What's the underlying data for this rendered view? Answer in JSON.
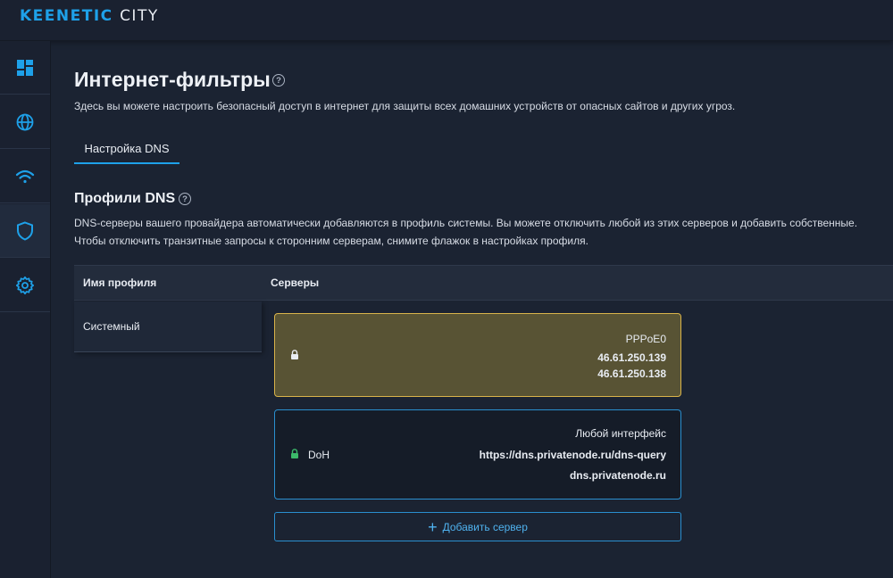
{
  "brand": {
    "name": "KEENETIC",
    "model": "CITY"
  },
  "sidebar": {
    "items": [
      {
        "name": "dashboard",
        "icon": "dashboard-icon"
      },
      {
        "name": "internet",
        "icon": "globe-icon"
      },
      {
        "name": "wifi",
        "icon": "wifi-icon"
      },
      {
        "name": "security",
        "icon": "shield-icon",
        "active": true
      },
      {
        "name": "settings",
        "icon": "gear-icon"
      }
    ]
  },
  "page": {
    "title": "Интернет-фильтры",
    "description": "Здесь вы можете настроить безопасный доступ в интернет для защиты всех домашних устройств от опасных сайтов и других угроз."
  },
  "tabs": [
    {
      "label": "Настройка DNS",
      "active": true
    }
  ],
  "section": {
    "title": "Профили DNS",
    "description_line1": "DNS-серверы вашего провайдера автоматически добавляются в профиль системы. Вы можете отключить любой из этих серверов и добавить собственные.",
    "description_line2": "Чтобы отключить транзитные запросы к сторонним серверам, снимите флажок в настройках профиля."
  },
  "table": {
    "col_profile": "Имя профиля",
    "col_servers": "Серверы",
    "profiles": [
      {
        "name": "Системный"
      }
    ]
  },
  "servers": [
    {
      "interface": "PPPoE0",
      "addresses": [
        "46.61.250.139",
        "46.61.250.138"
      ],
      "locked": true,
      "accent": "#d9b34a"
    },
    {
      "type": "DoH",
      "interface": "Любой интерфейс",
      "url": "https://dns.privatenode.ru/dns-query",
      "host": "dns.privatenode.ru",
      "lock_color": "#3cb96a",
      "accent": "#2a8fcf"
    }
  ],
  "add_server": {
    "label": "Добавить сервер"
  },
  "colors": {
    "accent": "#1ea1e9",
    "background": "#1b2332"
  }
}
